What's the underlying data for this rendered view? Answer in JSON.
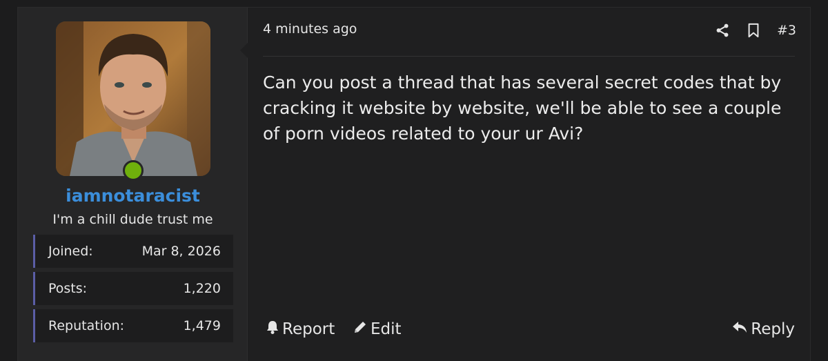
{
  "user": {
    "username": "iamnotaracist",
    "title": "I'm a chill dude trust me",
    "online": true,
    "stats": [
      {
        "label": "Joined:",
        "value": "Mar 8, 2026"
      },
      {
        "label": "Posts:",
        "value": "1,220"
      },
      {
        "label": "Reputation:",
        "value": "1,479"
      }
    ]
  },
  "post": {
    "timestamp": "4 minutes ago",
    "number": "#3",
    "message": "Can you post a thread that has several secret codes that by cracking it website by website, we'll be able to see a couple of porn videos related to your ur Avi?"
  },
  "actions": {
    "report_label": "Report",
    "edit_label": "Edit",
    "reply_label": "Reply",
    "share_icon": "share-icon",
    "bookmark_icon": "bookmark-icon"
  },
  "colors": {
    "username": "#3b8edb",
    "online": "#6fb00c",
    "stat_accent": "#5b5ea6"
  }
}
